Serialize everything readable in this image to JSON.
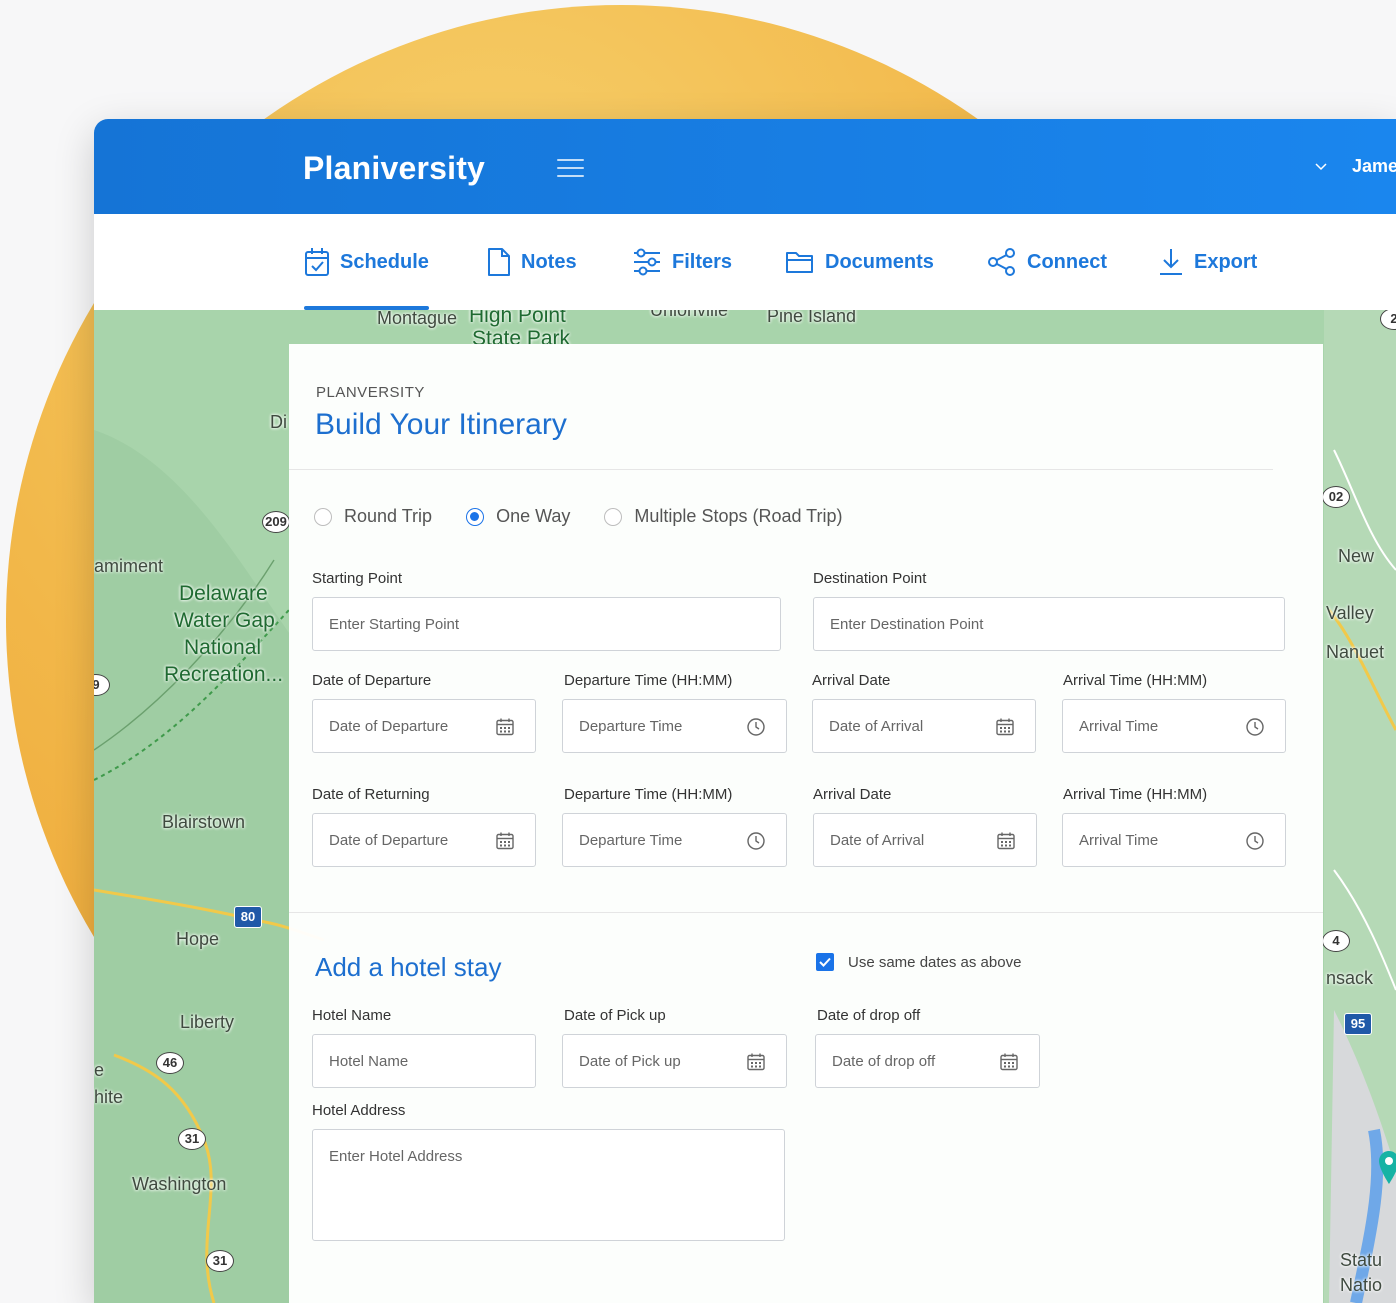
{
  "header": {
    "logo": "Planiversity",
    "user_name": "Jame"
  },
  "tabs": [
    {
      "label": "Schedule",
      "icon": "calendar-check-icon",
      "active": true
    },
    {
      "label": "Notes",
      "icon": "document-icon",
      "active": false
    },
    {
      "label": "Filters",
      "icon": "sliders-icon",
      "active": false
    },
    {
      "label": "Documents",
      "icon": "folder-icon",
      "active": false
    },
    {
      "label": "Connect",
      "icon": "share-icon",
      "active": false
    },
    {
      "label": "Export",
      "icon": "download-icon",
      "active": false
    }
  ],
  "map": {
    "labels": [
      "Montague",
      "High Point",
      "State Park",
      "Unionville",
      "Pine Island",
      "Delaware",
      "Water Gap",
      "National",
      "Recreation...",
      "amiment",
      "Blairstown",
      "Hope",
      "Liberty",
      "hite",
      "e",
      "Washington",
      "New",
      "Valley",
      "Nanuet",
      "nsack",
      "Statu",
      "Natio",
      "Di"
    ],
    "shields": [
      "209",
      "80",
      "46",
      "31",
      "31",
      "9",
      "02",
      "4",
      "95",
      "2"
    ]
  },
  "form": {
    "eyebrow": "PLANVERSITY",
    "title": "Build Your Itinerary",
    "trip_types": [
      {
        "label": "Round Trip",
        "selected": false
      },
      {
        "label": "One Way",
        "selected": true
      },
      {
        "label": "Multiple Stops (Road Trip)",
        "selected": false
      }
    ],
    "starting_point": {
      "label": "Starting Point",
      "placeholder": "Enter Starting Point"
    },
    "destination_point": {
      "label": "Destination Point",
      "placeholder": "Enter Destination Point"
    },
    "departure_row": {
      "date_label": "Date of Departure",
      "date_placeholder": "Date of Departure",
      "time_label": "Departure Time (HH:MM)",
      "time_placeholder": "Departure Time",
      "arrival_date_label": "Arrival Date",
      "arrival_date_placeholder": "Date of Arrival",
      "arrival_time_label": "Arrival Time (HH:MM)",
      "arrival_time_placeholder": "Arrival Time"
    },
    "return_row": {
      "date_label": "Date of Returning",
      "date_placeholder": "Date of Departure",
      "time_label": "Departure Time (HH:MM)",
      "time_placeholder": "Departure Time",
      "arrival_date_label": "Arrival Date",
      "arrival_date_placeholder": "Date of Arrival",
      "arrival_time_label": "Arrival Time (HH:MM)",
      "arrival_time_placeholder": "Arrival Time"
    },
    "hotel": {
      "title": "Add a hotel stay",
      "same_dates_label": "Use same dates as above",
      "same_dates_checked": true,
      "name_label": "Hotel Name",
      "name_placeholder": "Hotel Name",
      "pickup_label": "Date of Pick up",
      "pickup_placeholder": "Date of Pick up",
      "dropoff_label": "Date of drop off",
      "dropoff_placeholder": "Date of drop off",
      "address_label": "Hotel Address",
      "address_placeholder": "Enter Hotel Address"
    }
  },
  "colors": {
    "brand_blue": "#1a86ee",
    "accent_text": "#1d6fcf",
    "circle_yellow": "#f2b84a"
  }
}
